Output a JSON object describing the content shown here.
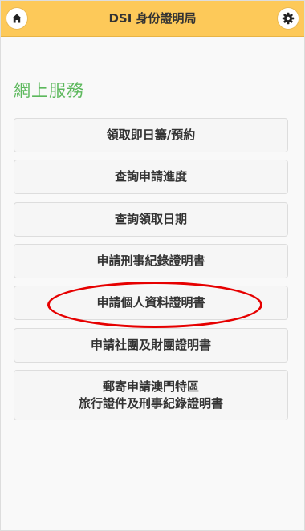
{
  "header": {
    "title": "DSI 身份證明局",
    "home_icon": "home-icon",
    "settings_icon": "gear-icon",
    "background": "#fdc959"
  },
  "section": {
    "title": "網上服務",
    "color": "#5cb85c"
  },
  "menu": {
    "items": [
      {
        "label": "領取即日籌/預約"
      },
      {
        "label": "查詢申請進度"
      },
      {
        "label": "查詢領取日期"
      },
      {
        "label": "申請刑事紀錄證明書"
      },
      {
        "label": "申請個人資料證明書",
        "highlighted": true
      },
      {
        "label": "申請社團及財團證明書"
      },
      {
        "label_line1": "郵寄申請澳門特區",
        "label_line2": "旅行證件及刑事紀錄證明書"
      }
    ]
  },
  "annotation": {
    "type": "red-ellipse-highlight",
    "color": "#e60000"
  }
}
